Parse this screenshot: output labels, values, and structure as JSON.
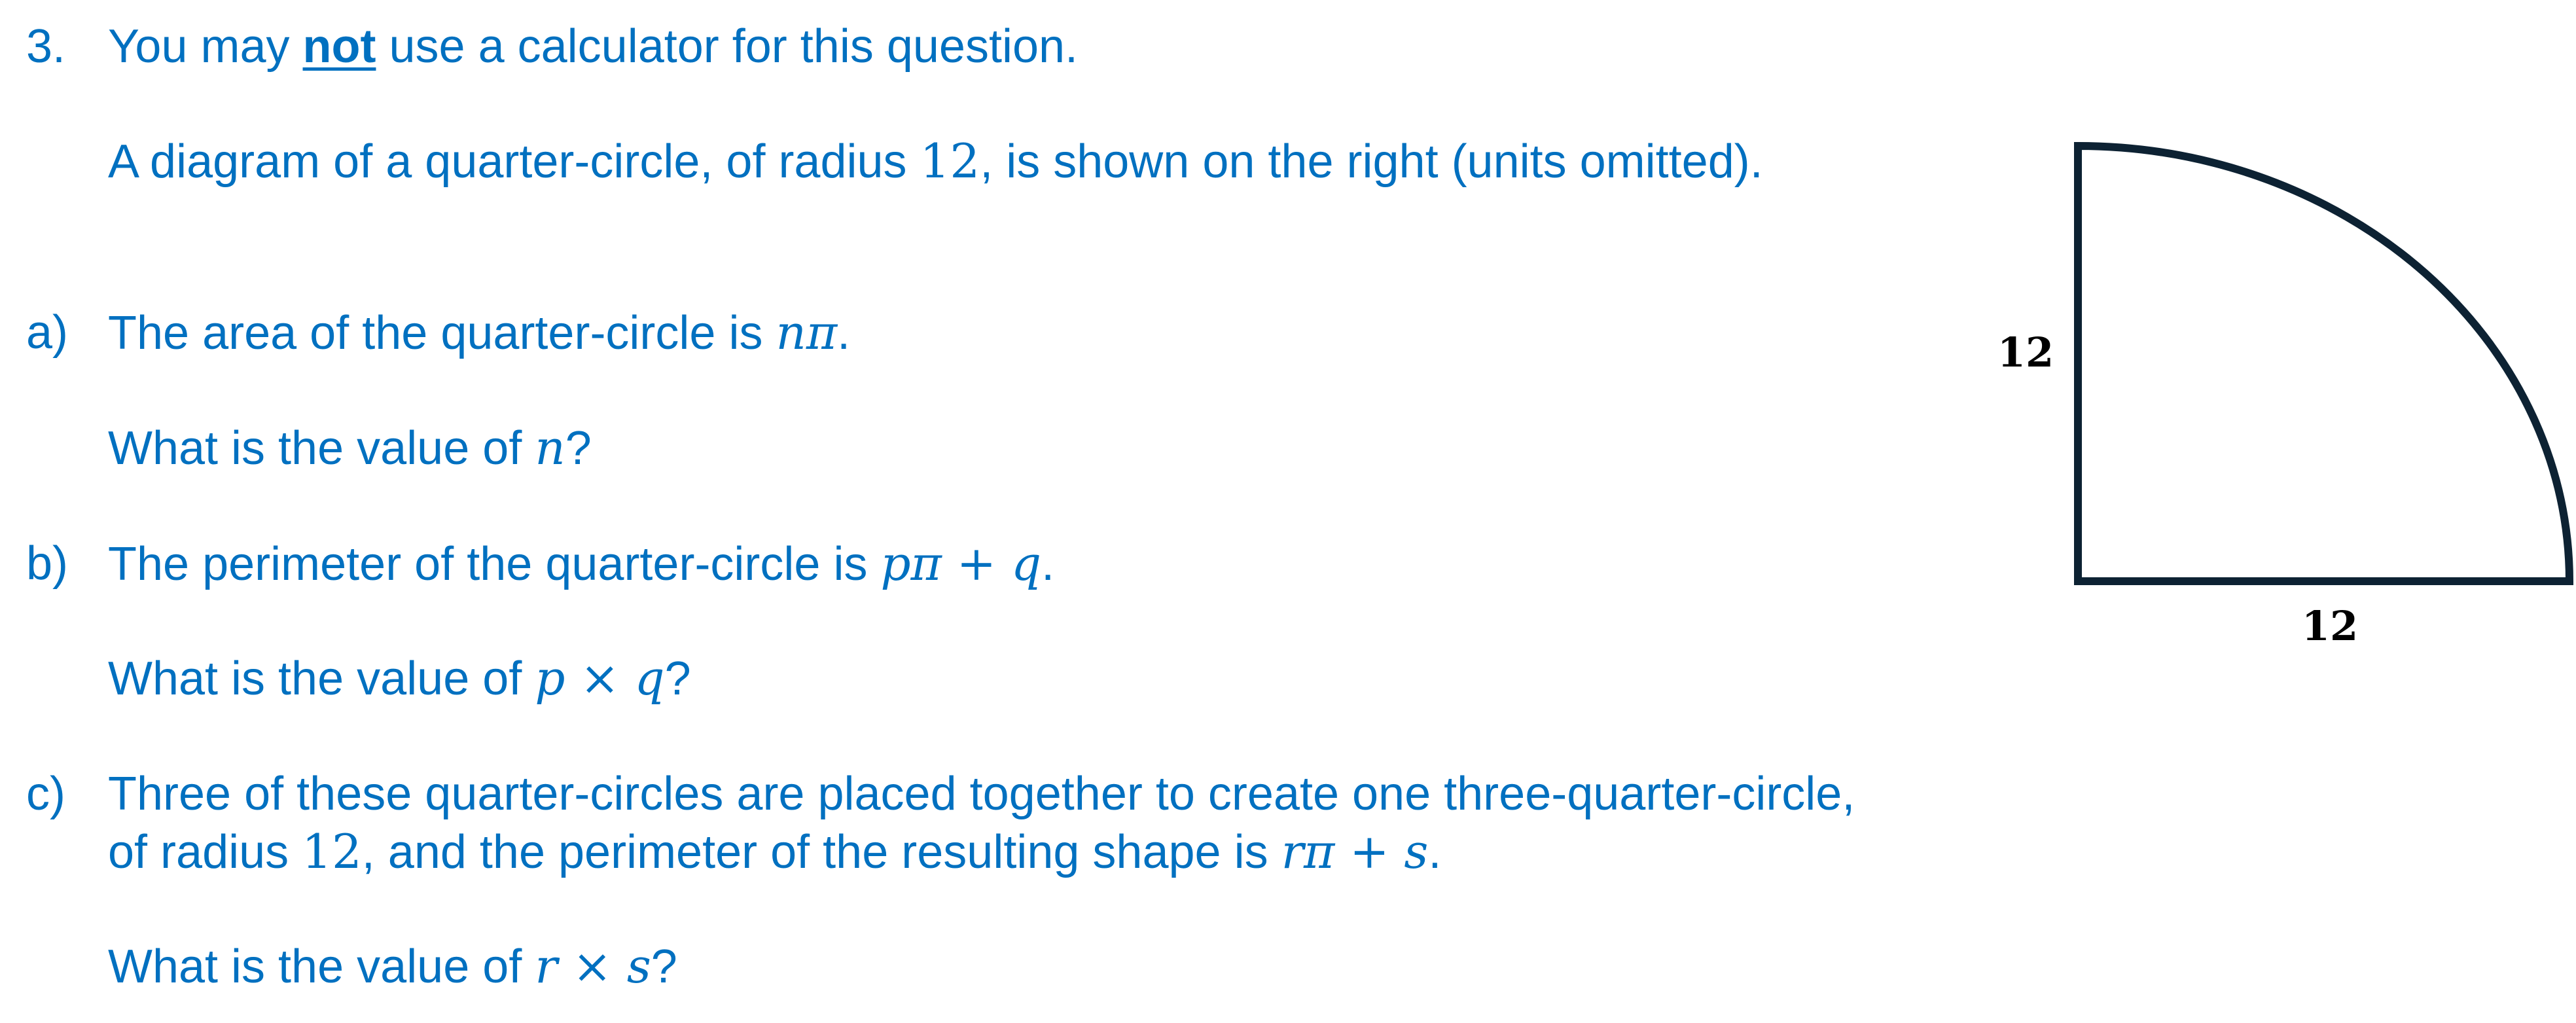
{
  "question": {
    "number": "3.",
    "intro_prefix": "You may ",
    "intro_emphasis": "not",
    "intro_suffix": " use a calculator for this question.",
    "desc_prefix": "A diagram of a quarter-circle, of radius ",
    "desc_radius": "12",
    "desc_suffix": ", is shown on the right (units omitted)."
  },
  "parts": {
    "a": {
      "label": "a)",
      "statement_prefix": "The area of the quarter-circle is ",
      "statement_math": "nπ",
      "statement_suffix": ".",
      "ask_prefix": "What is the value of ",
      "ask_math": "n",
      "ask_suffix": "?"
    },
    "b": {
      "label": "b)",
      "statement_prefix": "The perimeter of the quarter-circle is ",
      "statement_math": "pπ + q",
      "statement_suffix": ".",
      "ask_prefix": "What is the value of ",
      "ask_math": "p × q",
      "ask_suffix": "?"
    },
    "c": {
      "label": "c)",
      "line1": "Three of these quarter-circles are placed together to create one three-quarter-circle,",
      "line2_prefix": "of radius ",
      "line2_radius": "12",
      "line2_middle": ", and the perimeter of the resulting shape is ",
      "line2_math": "rπ + s",
      "line2_suffix": ".",
      "ask_prefix": "What is the value of ",
      "ask_math": "r × s",
      "ask_suffix": "?"
    }
  },
  "diagram": {
    "side_label_vertical": "12",
    "side_label_horizontal": "12",
    "stroke_color": "#0d2233"
  }
}
